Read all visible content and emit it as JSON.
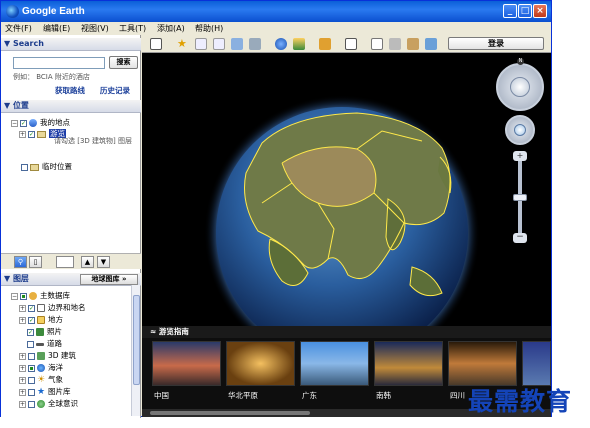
{
  "window": {
    "title": "Google Earth"
  },
  "menu": [
    "文件(F)",
    "编辑(E)",
    "视图(V)",
    "工具(T)",
    "添加(A)",
    "帮助(H)"
  ],
  "search": {
    "header": "▼ Search",
    "button": "搜索",
    "example": "例如：  BCIA 附近的酒店",
    "link_directions": "获取路线",
    "link_history": "历史记录"
  },
  "places": {
    "header": "▼ 位置",
    "my_places": "我的地点",
    "sightseeing": "游览",
    "sightseeing_desc": "请勾选 [3D 建筑物] 图层",
    "temporary": "临时位置"
  },
  "layers": {
    "header": "▼ 图层",
    "gallery_button": "地球图库 »",
    "items": [
      "主数据库",
      "边界和地名",
      "地方",
      "照片",
      "道路",
      "3D 建筑",
      "海洋",
      "气象",
      "图片库",
      "全球意识"
    ]
  },
  "toolbar": {
    "login": "登录"
  },
  "tours": {
    "header": "≈ 游览指南",
    "items": [
      "中国",
      "华北平原",
      "广东",
      "南韩",
      "四川"
    ]
  },
  "watermark": "最需教育",
  "colors": {
    "title_bar": "#0a5fd8",
    "view_bg": "#000000",
    "panel_header": "#1c3c8c"
  }
}
